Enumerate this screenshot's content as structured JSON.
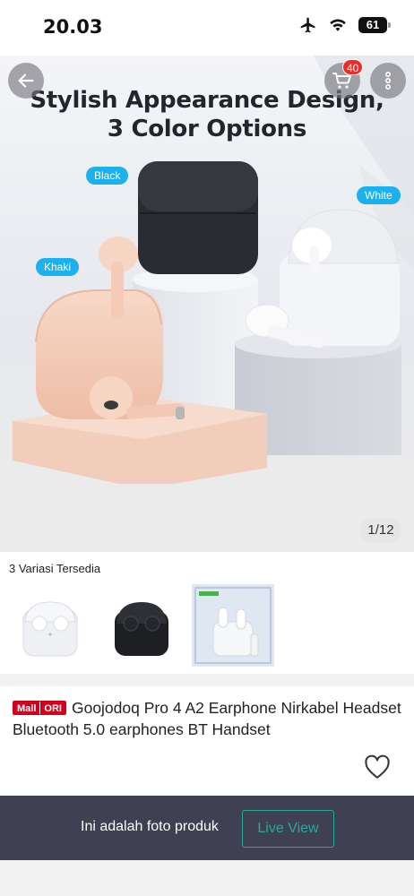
{
  "status_bar": {
    "time": "20.03",
    "battery": "61",
    "icons": [
      "airplane-icon",
      "wifi-icon",
      "battery-icon"
    ]
  },
  "top_nav": {
    "icons": [
      "back-arrow-icon",
      "cart-icon",
      "more-vertical-icon"
    ],
    "cart_badge": "40"
  },
  "hero": {
    "title_line1": "Stylish Appearance Design,",
    "title_line2": "3 Color Options",
    "color_tags": {
      "black": "Black",
      "white": "White",
      "khaki": "Khaki"
    },
    "page_counter": "1/12"
  },
  "variants": {
    "label": "3 Variasi Tersedia"
  },
  "product": {
    "mall_badge": "Mall",
    "ori_badge": "ORI",
    "title": "Goojodoq Pro 4  A2 Earphone Nirkabel Headset Bluetooth 5.0 earphones BT Handset"
  },
  "bottom_bar": {
    "text": "Ini adalah foto produk",
    "live_button": "Live View"
  },
  "colors": {
    "accent_teal": "#26aa99",
    "badge_red": "#ee2b24",
    "tag_blue": "#1ab1ee",
    "bar_dark": "#3f4152"
  }
}
